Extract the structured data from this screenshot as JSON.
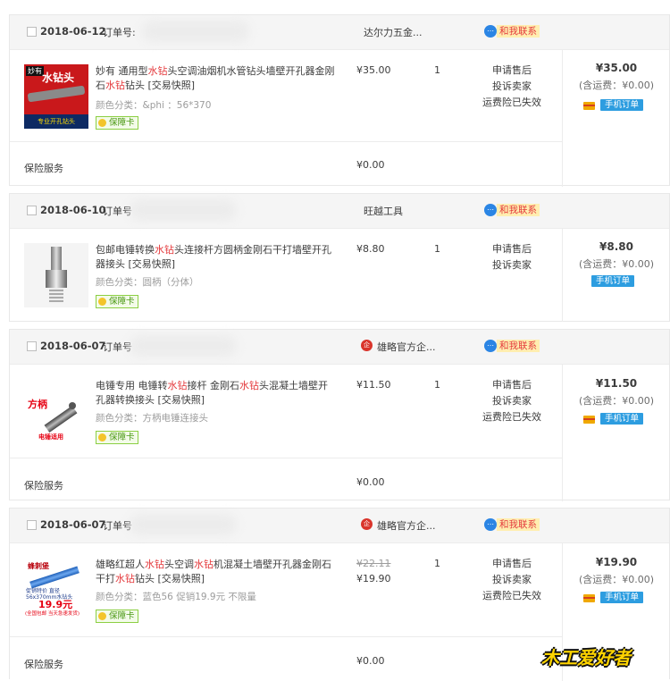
{
  "labels": {
    "order_no": "订单号:",
    "order_no_short": "订单号",
    "contact": "和我联系",
    "insurance": "保险服务",
    "insurance_price": "¥0.00",
    "after_sale": "申请售后",
    "complain": "投诉卖家",
    "freight_ins": "运费险已失效",
    "ship_fee": "(含运费：¥0.00)",
    "mobile_order": "手机订单",
    "guarantee": "保障卡"
  },
  "orders": [
    {
      "date": "2018-06-12",
      "shop": "达尔力五金...",
      "item": {
        "title_parts": [
          "妙有 通用型",
          "水钻",
          "头空调油烟机水管钻头墙壁开孔器金刚石",
          "水钻",
          "钻头 [交易快照]"
        ],
        "spec": "颜色分类：&phi  ：56*370",
        "price": "¥35.00",
        "qty": "1",
        "thumb_text": "水钻头",
        "thumb_sub": "专业开孔钻头",
        "thumb_tag": "妙有"
      },
      "total": "¥35.00"
    },
    {
      "date": "2018-06-10",
      "shop": "旺越工具",
      "item": {
        "title_parts": [
          "包邮电锤转换",
          "水钻",
          "头连接杆方圆柄金刚石干打墙壁开孔器接头 [交易快照]"
        ],
        "spec": "颜色分类：圆柄（分体）",
        "price": "¥8.80",
        "qty": "1"
      },
      "total": "¥8.80"
    },
    {
      "date": "2018-06-07",
      "shop": "雄略官方企...",
      "item": {
        "title_parts": [
          "电锤专用 电锤转",
          "水钻",
          "接杆 金刚石",
          "水钻",
          "头混凝土墙壁开孔器转换接头 [交易快照]"
        ],
        "spec": "颜色分类：方柄电锤连接头",
        "price": "¥11.50",
        "qty": "1",
        "thumb_text": "方柄",
        "thumb_sub": "电锤适用"
      },
      "total": "¥11.50"
    },
    {
      "date": "2018-06-07",
      "shop": "雄略官方企...",
      "item": {
        "title_parts": [
          "雄略红超人",
          "水钻",
          "头空调",
          "水钻",
          "机混凝土墙壁开孔器金刚石干打",
          "水钻",
          "钻头 [交易快照]"
        ],
        "spec": "颜色分类：蓝色56 促销19.9元 不限量",
        "price_old": "¥22.11",
        "price": "¥19.90",
        "qty": "1",
        "thumb_tag": "蜂刺堡",
        "thumb_price": "19.9元",
        "thumb_sub": "促销特价 直径56x370mm水钻头",
        "thumb_note": "(全国包邮 当天急速发货)"
      },
      "total": "¥19.90"
    }
  ],
  "watermark": "木工爱好者",
  "colors": {
    "highlight": "#e4393c",
    "mobile_badge": "#2d9de0",
    "contact_bg": "#ffeeb0",
    "header_bg": "#f5f5f5"
  }
}
